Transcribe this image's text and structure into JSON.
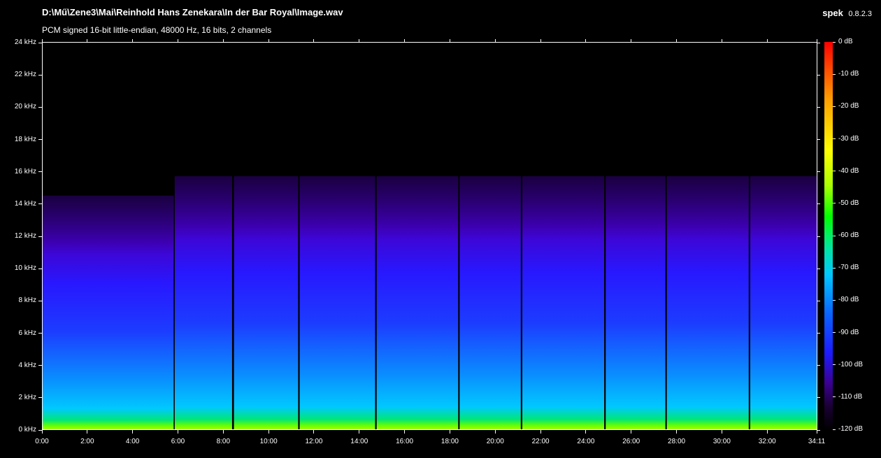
{
  "header": {
    "file_path": "D:\\Mű\\Zene3\\Mai\\Reinhold Hans Zenekara\\In der Bar Royal\\Image.wav",
    "format_info": "PCM signed 16-bit little-endian, 48000 Hz, 16 bits, 2 channels",
    "app_name": "spek",
    "app_version": "0.8.2.3"
  },
  "chart_data": {
    "type": "heatmap",
    "y_ticks": [
      "0 kHz",
      "2 kHz",
      "4 kHz",
      "6 kHz",
      "8 kHz",
      "10 kHz",
      "12 kHz",
      "14 kHz",
      "16 kHz",
      "18 kHz",
      "20 kHz",
      "22 kHz",
      "24 kHz"
    ],
    "y_range_khz": [
      0,
      24
    ],
    "x_ticks": [
      "0:00",
      "2:00",
      "4:00",
      "6:00",
      "8:00",
      "10:00",
      "12:00",
      "14:00",
      "16:00",
      "18:00",
      "20:00",
      "22:00",
      "24:00",
      "26:00",
      "28:00",
      "30:00",
      "32:00",
      "34:11"
    ],
    "x_tick_seconds": [
      0,
      120,
      240,
      360,
      480,
      600,
      720,
      840,
      960,
      1080,
      1200,
      1320,
      1440,
      1560,
      1680,
      1800,
      1920,
      2051
    ],
    "duration_seconds": 2051,
    "colorbar_ticks": [
      "0 dB",
      "-10 dB",
      "-20 dB",
      "-30 dB",
      "-40 dB",
      "-50 dB",
      "-60 dB",
      "-70 dB",
      "-80 dB",
      "-90 dB",
      "-100 dB",
      "-110 dB",
      "-120 dB"
    ],
    "db_range": [
      -120,
      0
    ],
    "colormap": [
      "#000000",
      "#1a0033",
      "#4b00a0",
      "#1c1cff",
      "#0a64ff",
      "#00c8ff",
      "#00e6a0",
      "#00ff00",
      "#aaff00",
      "#ffff00",
      "#ffa000",
      "#ff0000"
    ],
    "tracks": [
      {
        "start_s": 0,
        "end_s": 347,
        "cutoff_khz": 14.5
      },
      {
        "start_s": 350,
        "end_s": 502,
        "cutoff_khz": 15.7
      },
      {
        "start_s": 507,
        "end_s": 677,
        "cutoff_khz": 15.7
      },
      {
        "start_s": 681,
        "end_s": 881,
        "cutoff_khz": 15.7
      },
      {
        "start_s": 885,
        "end_s": 1101,
        "cutoff_khz": 15.7
      },
      {
        "start_s": 1105,
        "end_s": 1267,
        "cutoff_khz": 15.7
      },
      {
        "start_s": 1271,
        "end_s": 1488,
        "cutoff_khz": 15.7
      },
      {
        "start_s": 1492,
        "end_s": 1650,
        "cutoff_khz": 15.7
      },
      {
        "start_s": 1654,
        "end_s": 1871,
        "cutoff_khz": 15.7
      },
      {
        "start_s": 1875,
        "end_s": 2051,
        "cutoff_khz": 15.7
      }
    ]
  }
}
